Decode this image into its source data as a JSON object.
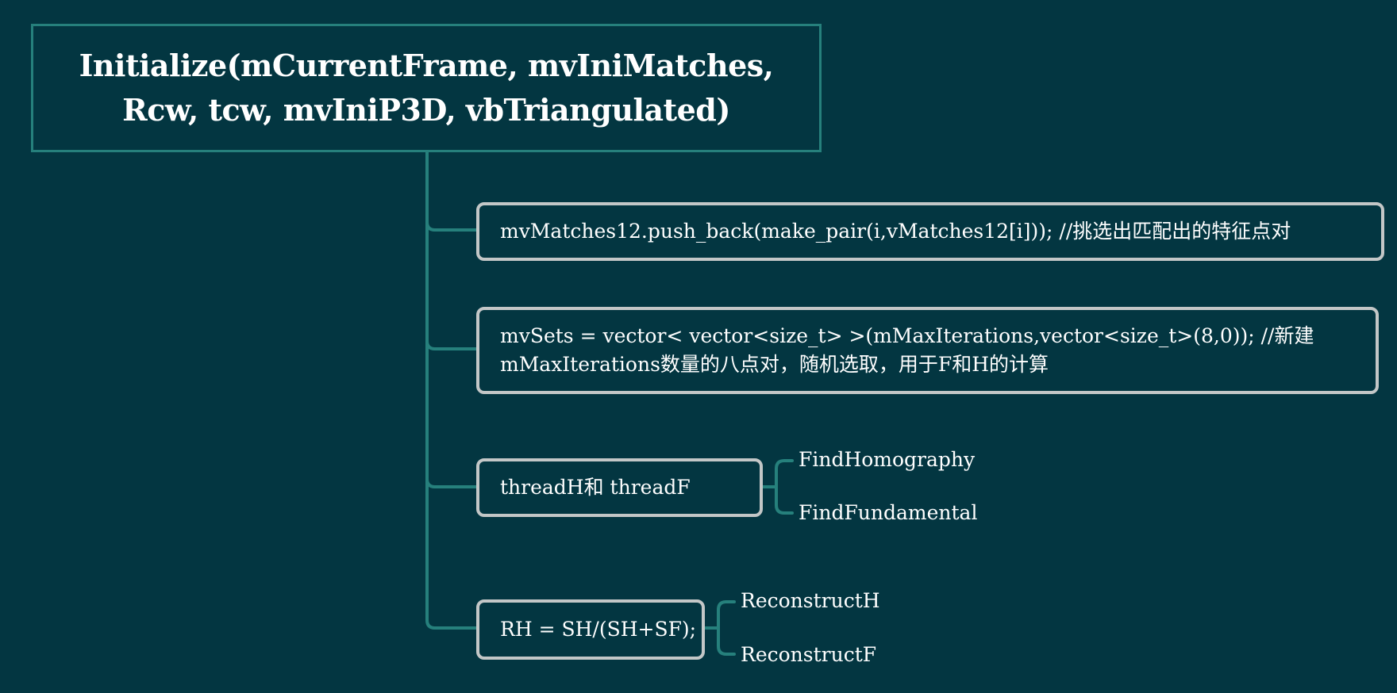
{
  "root": {
    "title": "Initialize(mCurrentFrame, mvIniMatches,\nRcw, tcw, mvIniP3D, vbTriangulated)"
  },
  "nodes": [
    {
      "text": "mvMatches12.push_back(make_pair(i,vMatches12[i]));  //挑选出匹配出的特征点对",
      "children": []
    },
    {
      "text": "mvSets = vector< vector<size_t> >(mMaxIterations,vector<size_t>(8,0)); //新建\nmMaxIterations数量的八点对，随机选取，用于F和H的计算",
      "children": []
    },
    {
      "text": "threadH和 threadF",
      "children": [
        "FindHomography",
        "FindFundamental"
      ]
    },
    {
      "text": "RH = SH/(SH+SF);",
      "children": [
        "ReconstructH",
        "ReconstructF"
      ]
    }
  ],
  "colors": {
    "background": "#033641",
    "root_border": "#26807c",
    "connector": "#26807c",
    "node_border": "#c3c7c7",
    "text": "#ffffff"
  }
}
